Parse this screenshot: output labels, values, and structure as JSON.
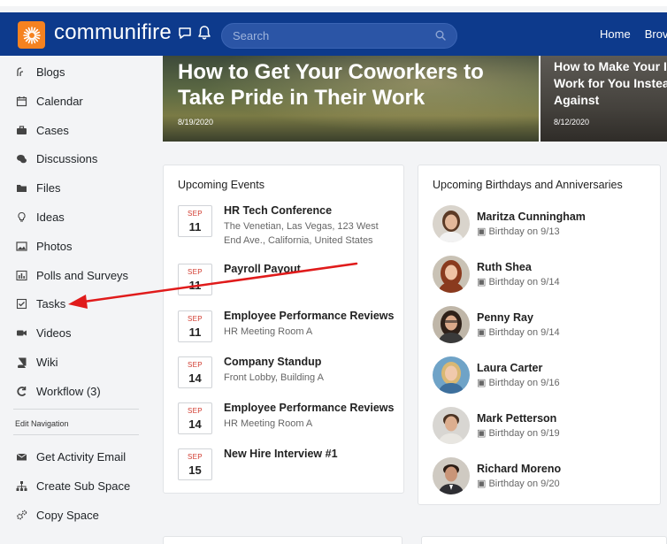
{
  "header": {
    "brand": "communifire",
    "search_placeholder": "Search",
    "nav": [
      "Home",
      "Brov"
    ]
  },
  "sidebar": {
    "items": [
      {
        "label": "Blogs",
        "icon": "blog-icon"
      },
      {
        "label": "Calendar",
        "icon": "calendar-icon"
      },
      {
        "label": "Cases",
        "icon": "briefcase-icon"
      },
      {
        "label": "Discussions",
        "icon": "chat-icon"
      },
      {
        "label": "Files",
        "icon": "folder-icon"
      },
      {
        "label": "Ideas",
        "icon": "lightbulb-icon"
      },
      {
        "label": "Photos",
        "icon": "image-icon"
      },
      {
        "label": "Polls and Surveys",
        "icon": "bar-chart-icon"
      },
      {
        "label": "Tasks",
        "icon": "checkbox-icon"
      },
      {
        "label": "Videos",
        "icon": "video-camera-icon"
      },
      {
        "label": "Wiki",
        "icon": "book-icon"
      },
      {
        "label": "Workflow (3)",
        "icon": "workflow-icon"
      }
    ],
    "edit_navigation_label": "Edit Navigation",
    "actions": [
      {
        "label": "Get Activity Email",
        "icon": "envelope-icon"
      },
      {
        "label": "Create Sub Space",
        "icon": "sitemap-icon"
      },
      {
        "label": "Copy Space",
        "icon": "gears-icon"
      }
    ]
  },
  "hero": [
    {
      "title": "How to Get Your Coworkers to Take Pride in Their Work",
      "date": "8/19/2020"
    },
    {
      "title": "How to Make Your Intranet Work for You Instead of Against",
      "date": "8/12/2020"
    }
  ],
  "events": {
    "title": "Upcoming Events",
    "items": [
      {
        "month": "SEP",
        "day": "11",
        "title": "HR Tech Conference",
        "subtitle": "The Venetian, Las Vegas, 123 West End Ave., California, United States"
      },
      {
        "month": "SEP",
        "day": "11",
        "title": "Payroll Payout",
        "subtitle": ""
      },
      {
        "month": "SEP",
        "day": "11",
        "title": "Employee Performance Reviews",
        "subtitle": "HR Meeting Room A"
      },
      {
        "month": "SEP",
        "day": "14",
        "title": "Company Standup",
        "subtitle": "Front Lobby, Building A"
      },
      {
        "month": "SEP",
        "day": "14",
        "title": "Employee Performance Reviews",
        "subtitle": "HR Meeting Room A"
      },
      {
        "month": "SEP",
        "day": "15",
        "title": "New Hire Interview #1",
        "subtitle": ""
      }
    ]
  },
  "birthdays": {
    "title": "Upcoming Birthdays and Anniversaries",
    "items": [
      {
        "name": "Maritza Cunningham",
        "detail": "Birthday on 9/13"
      },
      {
        "name": "Ruth Shea",
        "detail": "Birthday on 9/14"
      },
      {
        "name": "Penny Ray",
        "detail": "Birthday on 9/14"
      },
      {
        "name": "Laura Carter",
        "detail": "Birthday on 9/16"
      },
      {
        "name": "Mark Petterson",
        "detail": "Birthday on 9/19"
      },
      {
        "name": "Richard Moreno",
        "detail": "Birthday on 9/20"
      }
    ]
  },
  "colors": {
    "header_bg": "#0d3a8c",
    "logo_orange": "#f58220",
    "arrow_red": "#e01b1b",
    "month_red": "#d13b2f"
  }
}
